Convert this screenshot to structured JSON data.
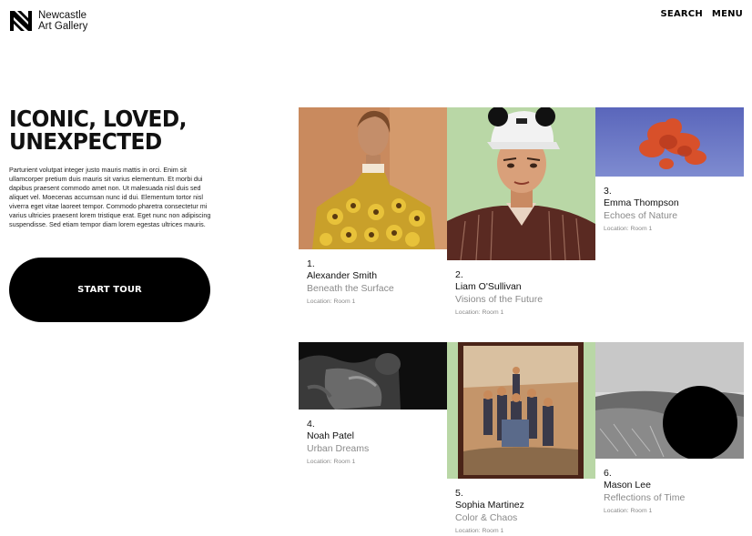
{
  "header": {
    "logo_line1": "Newcastle",
    "logo_line2": "Art Gallery",
    "nav_search": "SEARCH",
    "nav_menu": "MENU"
  },
  "hero": {
    "title_line1": "ICONIC, LOVED,",
    "title_line2": "UNEXPECTED",
    "body": "Parturient volutpat integer justo mauris mattis in orci. Enim sit ullamcorper pretium duis mauris sit varius elementum. Et morbi dui dapibus praesent commodo amet non. Ut malesuada nisl duis sed aliquet vel. Moecenas accumsan nunc id dui. Elementum tortor nisl viverra eget vitae laoreet tempor. Commodo pharetra consectetur mi varius ultricies praesent lorem tristique erat. Eget nunc non adipiscing suspendisse. Sed etiam tempor diam lorem egestas ultrices mauris.",
    "cta": "START TOUR"
  },
  "artworks": [
    {
      "num": "1.",
      "artist": "Alexander Smith",
      "title": "Beneath the Surface",
      "location": "Location: Room 1"
    },
    {
      "num": "2.",
      "artist": "Liam O'Sullivan",
      "title": "Visions of the Future",
      "location": "Location: Room 1"
    },
    {
      "num": "3.",
      "artist": "Emma Thompson",
      "title": "Echoes of Nature",
      "location": "Location: Room 1"
    },
    {
      "num": "4.",
      "artist": "Noah Patel",
      "title": "Urban Dreams",
      "location": "Location: Room 1"
    },
    {
      "num": "5.",
      "artist": "Sophia Martinez",
      "title": "Color & Chaos",
      "location": "Location: Room 1"
    },
    {
      "num": "6.",
      "artist": "Mason Lee",
      "title": "Reflections of Time",
      "location": "Location: Room 1"
    }
  ],
  "colors": {
    "black": "#000000",
    "muted_text": "#8a8a8a",
    "portrait_bg": "#c98a5e",
    "painting_green": "#b9d7a6",
    "sky_blue": "#6a79c4",
    "cloud_orange": "#d8502a"
  }
}
